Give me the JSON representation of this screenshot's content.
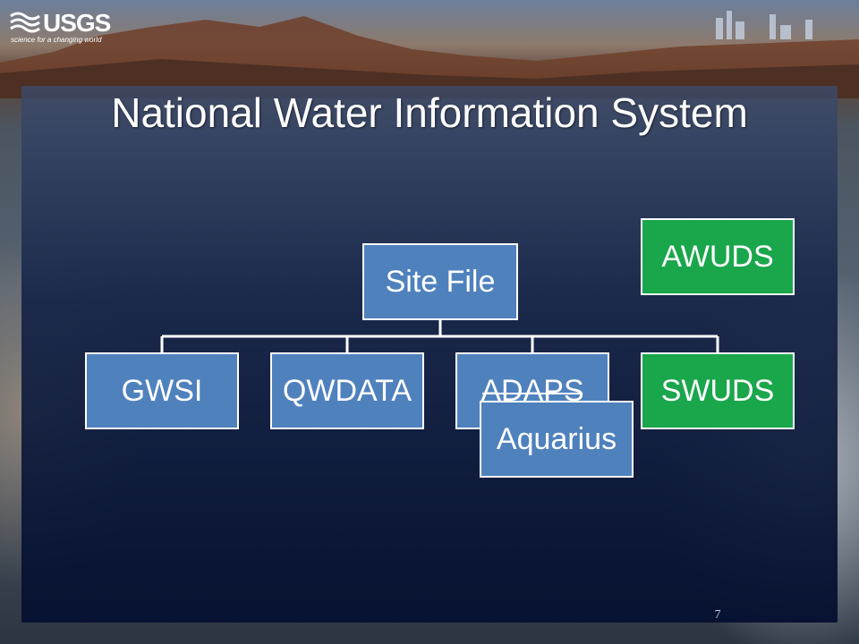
{
  "logo": {
    "name": "USGS",
    "tagline": "science for a changing world"
  },
  "title": "National Water Information System",
  "diagram": {
    "root": {
      "label": "Site File",
      "color": "#4f81bd"
    },
    "standalone": {
      "label": "AWUDS",
      "color": "#1aa64b"
    },
    "children": [
      {
        "label": "GWSI",
        "color": "#4f81bd"
      },
      {
        "label": "QWDATA",
        "color": "#4f81bd"
      },
      {
        "label": "ADAPS",
        "color": "#4f81bd",
        "struck_through": true
      },
      {
        "label": "SWUDS",
        "color": "#1aa64b"
      }
    ],
    "replacement": {
      "label": "Aquarius",
      "replaces": "ADAPS",
      "color": "#4f81bd"
    }
  },
  "page_number": "7"
}
